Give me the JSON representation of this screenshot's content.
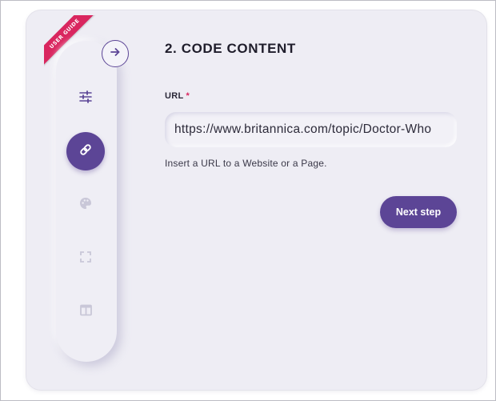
{
  "ribbon": {
    "label": "USER GUIDE"
  },
  "sidebar": {
    "collapse_icon": "arrow-right-icon",
    "items": [
      {
        "icon": "sliders-icon",
        "active": false
      },
      {
        "icon": "link-icon",
        "active": true
      },
      {
        "icon": "palette-icon",
        "active": false
      },
      {
        "icon": "fullscreen-icon",
        "active": false
      },
      {
        "icon": "layout-icon",
        "active": false
      }
    ]
  },
  "main": {
    "title": "2. CODE CONTENT",
    "url_label": "URL",
    "required_mark": "*",
    "url_value": "https://www.britannica.com/topic/Doctor-Who",
    "hint": "Insert a URL to a Website or a Page.",
    "next_button": "Next step"
  },
  "colors": {
    "accent": "#5c4596",
    "ribbon": "#d9265f",
    "background": "#eeedf4",
    "icon_muted": "#c9c7d8"
  }
}
